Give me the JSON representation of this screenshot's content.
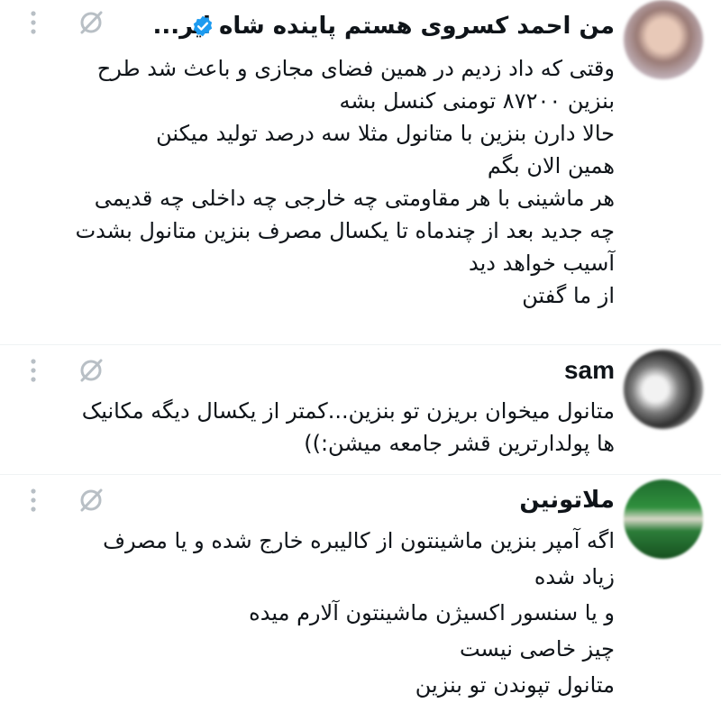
{
  "posts": [
    {
      "author": "من احمد کسروی هستم پاینده شاه ایر...",
      "verified": true,
      "lines": [
        "وقتی که داد زدیم در همین فضای مجازی و باعث شد طرح",
        "بنزین ۸۷۲۰۰ تومنی کنسل بشه",
        "حالا دارن بنزین با متانول مثلا سه درصد تولید میکنن",
        "همین الان بگم",
        "هر ماشینی با هر مقاومتی چه خارجی چه داخلی چه قدیمی",
        "چه جدید بعد از چندماه تا یکسال مصرف بنزین متانول بشدت",
        "آسیب خواهد دید",
        "از ما گفتن"
      ]
    },
    {
      "author": "sam",
      "verified": false,
      "lines": [
        "متانول میخوان بریزن تو بنزین...کمتر از یکسال دیگه مکانیک",
        "ها پولدارترین قشر جامعه میشن:))"
      ]
    },
    {
      "author": "ملاتونین",
      "verified": false,
      "lines": [
        "اگه آمپر بنزین ماشینتون از کالیبره خارج شده و یا مصرف",
        "زیاد شده",
        " و یا سنسور اکسیژن ماشینتون آلارم میده",
        "چیز خاصی نیست",
        "متانول تپوندن تو بنزین"
      ]
    }
  ],
  "icons": {
    "more": "more-vertical-icon",
    "mute": "muted-circle-icon",
    "verified": "verified-badge-icon"
  },
  "colors": {
    "verified": "#1d9bf0",
    "icon_gray": "#b8bfc5",
    "text": "#0f1419"
  }
}
